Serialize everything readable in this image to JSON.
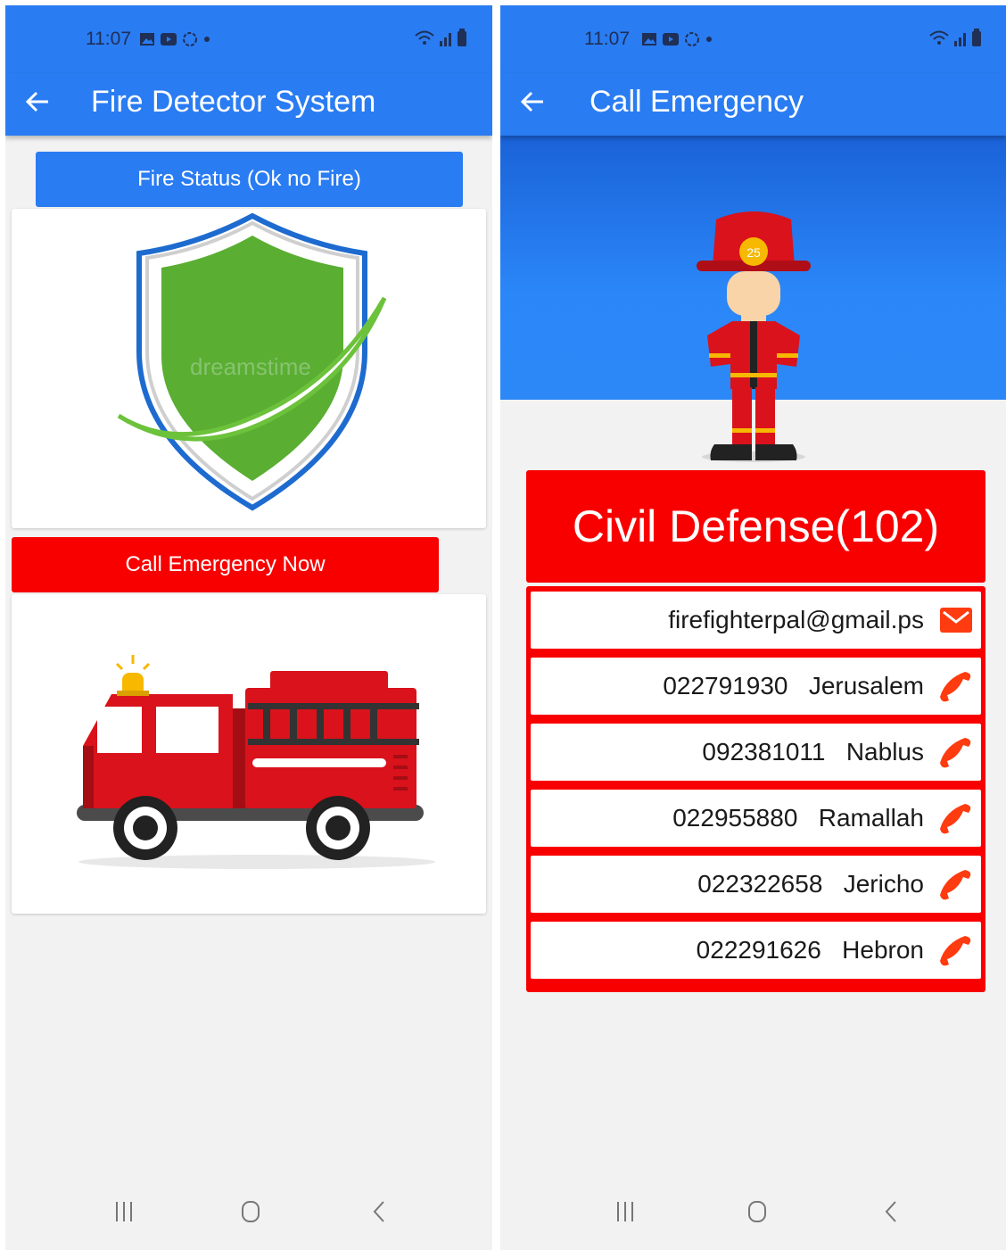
{
  "status_bar": {
    "time": "11:07"
  },
  "screen_main": {
    "title": "Fire Detector System",
    "back_icon": "arrow-back-icon",
    "status_button": "Fire Status (Ok no Fire)",
    "status_color": "#2a7cf2",
    "shield_watermark": "dreamstime",
    "emergency_button": "Call Emergency Now",
    "emergency_color": "#f80000"
  },
  "screen_emergency": {
    "title": "Call Emergency",
    "header": "Civil Defense(102)",
    "contacts": [
      {
        "text": "firefighterpal@gmail.ps",
        "icon": "email-icon"
      },
      {
        "text": "022791930   Jerusalem",
        "icon": "phone-icon"
      },
      {
        "text": "092381011   Nablus",
        "icon": "phone-icon"
      },
      {
        "text": "022955880   Ramallah",
        "icon": "phone-icon"
      },
      {
        "text": "022322658   Jericho",
        "icon": "phone-icon"
      },
      {
        "text": "022291626   Hebron",
        "icon": "phone-icon"
      }
    ]
  },
  "nav_bar": {
    "icons": [
      "recent-apps-icon",
      "home-icon",
      "back-nav-icon"
    ]
  }
}
